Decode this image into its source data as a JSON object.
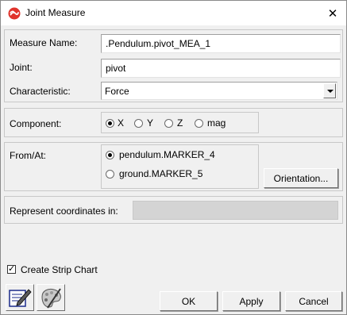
{
  "window": {
    "title": "Joint Measure"
  },
  "fields": {
    "measure_name_label": "Measure Name:",
    "measure_name_value": ".Pendulum.pivot_MEA_1",
    "joint_label": "Joint:",
    "joint_value": "pivot",
    "characteristic_label": "Characteristic:",
    "characteristic_value": "Force"
  },
  "component": {
    "label": "Component:",
    "options": [
      "X",
      "Y",
      "Z",
      "mag"
    ],
    "selected": "X"
  },
  "from_at": {
    "label": "From/At:",
    "options": [
      "pendulum.MARKER_4",
      "ground.MARKER_5"
    ],
    "selected": "pendulum.MARKER_4",
    "orientation_button": "Orientation..."
  },
  "represent": {
    "label": "Represent coordinates in:",
    "value": ""
  },
  "strip_chart": {
    "label": "Create Strip Chart",
    "checked": true
  },
  "buttons": {
    "ok": "OK",
    "apply": "Apply",
    "cancel": "Cancel"
  },
  "icons": {
    "app": "adams-logo-icon",
    "close": "close-icon",
    "notes": "notepad-icon",
    "appearance": "palette-icon"
  }
}
